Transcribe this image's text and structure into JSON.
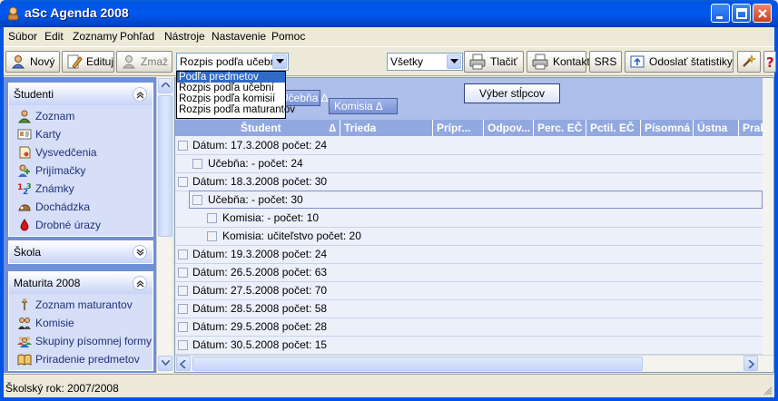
{
  "window": {
    "title": "aSc Agenda 2008"
  },
  "menu": [
    "Súbor",
    "Edit",
    "Zoznamy",
    "Pohľad",
    "Nástroje",
    "Nastavenie",
    "Pomoc"
  ],
  "toolbar": {
    "new_label": "Nový",
    "edit_label": "Edituj",
    "delete_label": "Zmaž",
    "view_combo_value": "Rozpis podľa učebn",
    "filter_combo_value": "Všetky",
    "print_label": "Tlačiť",
    "contact_label": "Kontakt",
    "srs_label": "SRS",
    "send_stats_label": "Odoslať štatistiky"
  },
  "dropdown": {
    "items": [
      "Podľa predmetov",
      "Rozpis podľa učební",
      "Rozpis podľa komisií",
      "Rozpis podľa maturantov"
    ],
    "selected_index": 0
  },
  "sidebar": {
    "groups": [
      {
        "title": "Študenti",
        "expanded": true,
        "items": [
          {
            "label": "Zoznam",
            "icon": "students-list-icon"
          },
          {
            "label": "Karty",
            "icon": "cards-icon"
          },
          {
            "label": "Vysvedčenia",
            "icon": "certificate-icon"
          },
          {
            "label": "Prijímačky",
            "icon": "admissions-icon"
          },
          {
            "label": "Známky",
            "icon": "grades-icon"
          },
          {
            "label": "Dochádzka",
            "icon": "attendance-icon"
          },
          {
            "label": "Drobné úrazy",
            "icon": "injury-drop-icon"
          }
        ]
      },
      {
        "title": "Škola",
        "expanded": false,
        "items": []
      },
      {
        "title": "Maturita 2008",
        "expanded": true,
        "items": [
          {
            "label": "Zoznam maturantov",
            "icon": "graduates-icon"
          },
          {
            "label": "Komisie",
            "icon": "commission-icon"
          },
          {
            "label": "Skupiny písomnej formy",
            "icon": "groups-icon"
          },
          {
            "label": "Priradenie predmetov",
            "icon": "book-icon"
          }
        ]
      }
    ]
  },
  "grid": {
    "group_chips": [
      "Učebňa",
      "Komisia"
    ],
    "column_chooser_label": "Výber stĺpcov",
    "columns": [
      "Študent",
      "Trieda",
      "Prípr...",
      "Odpov...",
      "Perc. EČ",
      "Pctil. EČ",
      "Písomná",
      "Ústna",
      "Praktic"
    ],
    "rows": [
      {
        "level": 0,
        "text": "Dátum:  17.3.2008  počet: 24"
      },
      {
        "level": 1,
        "text": "Učebňa:  -  počet: 24"
      },
      {
        "level": 0,
        "text": "Dátum:  18.3.2008  počet: 30"
      },
      {
        "level": 1,
        "text": "Učebňa:  -  počet: 30"
      },
      {
        "level": 2,
        "text": "Komisia:  -  počet: 10"
      },
      {
        "level": 2,
        "text": "Komisia:  učiteľstvo  počet: 20"
      },
      {
        "level": 0,
        "text": "Dátum:  19.3.2008  počet: 24"
      },
      {
        "level": 0,
        "text": "Dátum:  26.5.2008  počet: 63"
      },
      {
        "level": 0,
        "text": "Dátum:  27.5.2008  počet: 70"
      },
      {
        "level": 0,
        "text": "Dátum:  28.5.2008  počet: 58"
      },
      {
        "level": 0,
        "text": "Dátum:  29.5.2008  počet: 28"
      },
      {
        "level": 0,
        "text": "Dátum:  30.5.2008  počet: 15"
      }
    ]
  },
  "status": {
    "text": "Školský rok: 2007/2008"
  }
}
